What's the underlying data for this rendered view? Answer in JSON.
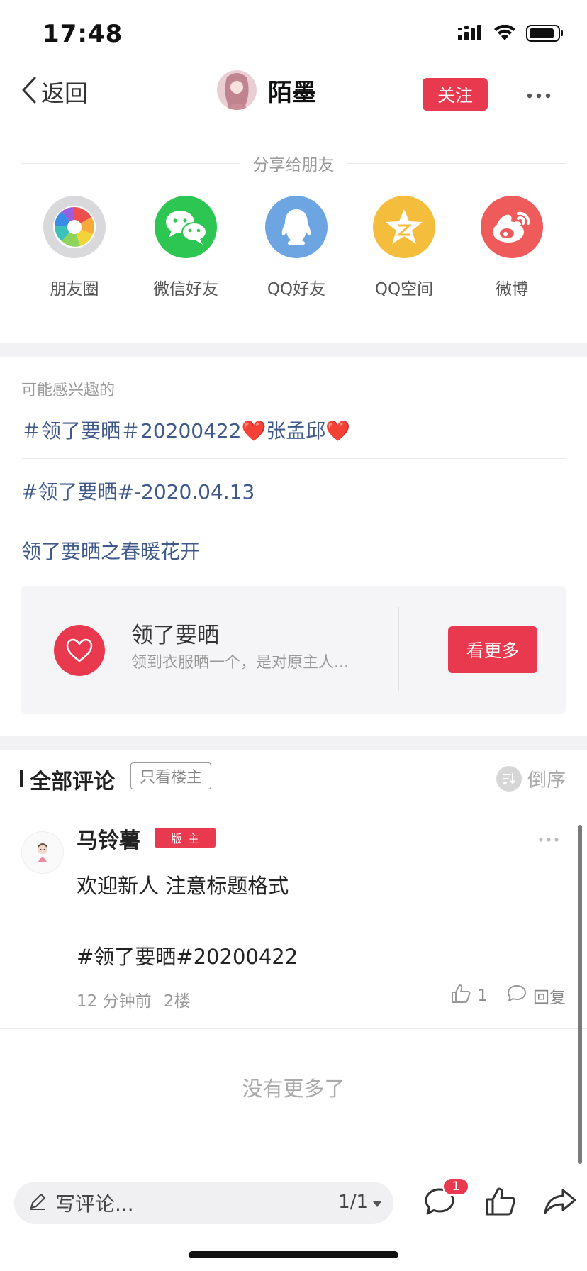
{
  "status_bar": {
    "time": "17:48"
  },
  "nav": {
    "back_label": "返回",
    "username": "陌墨",
    "follow_label": "关注"
  },
  "share": {
    "title": "分享给朋友",
    "items": [
      {
        "label": "朋友圈",
        "icon": "moments-icon",
        "color": "#d9d9dc"
      },
      {
        "label": "微信好友",
        "icon": "wechat-icon",
        "color": "#2dc653"
      },
      {
        "label": "QQ好友",
        "icon": "qq-icon",
        "color": "#6ca5e2"
      },
      {
        "label": "QQ空间",
        "icon": "qzone-icon",
        "color": "#f5bd3c"
      },
      {
        "label": "微博",
        "icon": "weibo-icon",
        "color": "#ef5a5a"
      }
    ]
  },
  "interests": {
    "label": "可能感兴趣的",
    "topics": [
      "＃领了要晒＃20200422❤️张孟邱❤️",
      "#领了要晒#-2020.04.13",
      "领了要晒之春暖花开"
    ]
  },
  "promo": {
    "title": "领了要晒",
    "desc": "领到衣服晒一个，是对原主人...",
    "button_label": "看更多"
  },
  "comments": {
    "title": "全部评论",
    "filter_label": "只看楼主",
    "sort_label": "倒序",
    "items": [
      {
        "author": "马铃薯",
        "badge": "版主",
        "line1": "欢迎新人 注意标题格式",
        "line2": "#领了要晒#20200422",
        "time": "12 分钟前",
        "floor": "2楼",
        "likes": "1",
        "reply_label": "回复"
      }
    ],
    "no_more": "没有更多了"
  },
  "bottom_bar": {
    "input_placeholder": "写评论...",
    "page_indicator": "1/1",
    "comment_badge": "1"
  },
  "colors": {
    "accent": "#e8394f",
    "topic_link": "#3f5a8a"
  }
}
